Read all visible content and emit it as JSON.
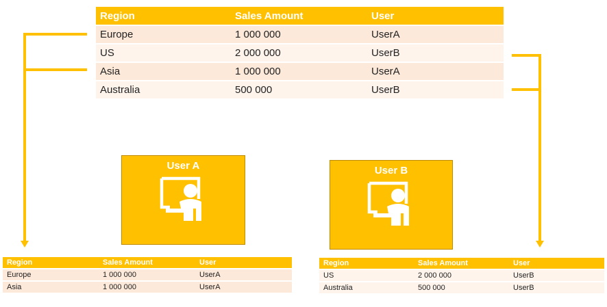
{
  "columns": [
    "Region",
    "Sales Amount",
    "User"
  ],
  "main_rows": [
    {
      "region": "Europe",
      "amount": "1 000 000",
      "user": "UserA"
    },
    {
      "region": "US",
      "amount": "2 000 000",
      "user": "UserB"
    },
    {
      "region": "Asia",
      "amount": "1 000 000",
      "user": "UserA"
    },
    {
      "region": "Australia",
      "amount": "500 000",
      "user": "UserB"
    }
  ],
  "user_a": {
    "title": "User A",
    "icon": "user-presentation-icon",
    "rows": [
      {
        "region": "Europe",
        "amount": "1 000 000",
        "user": "UserA"
      },
      {
        "region": "Asia",
        "amount": "1 000 000",
        "user": "UserA"
      }
    ]
  },
  "user_b": {
    "title": "User B",
    "icon": "user-presentation-icon",
    "rows": [
      {
        "region": "US",
        "amount": "2 000 000",
        "user": "UserB"
      },
      {
        "region": "Australia",
        "amount": "500 000",
        "user": "UserB"
      }
    ]
  },
  "colors": {
    "accent": "#ffc000",
    "row_odd": "#fde9d9",
    "row_even": "#fef4ec"
  }
}
